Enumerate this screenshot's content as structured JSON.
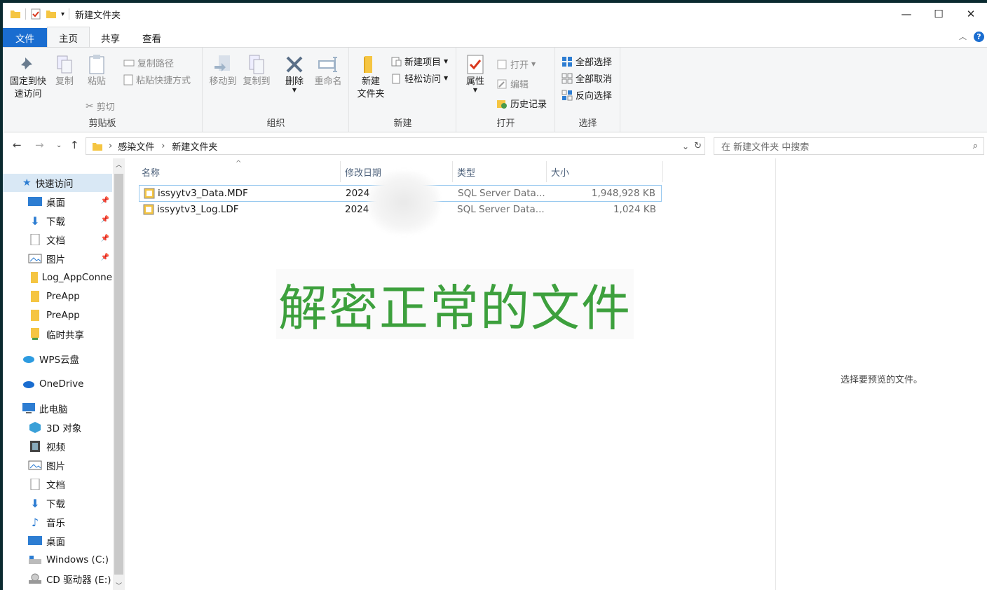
{
  "window": {
    "title": "新建文件夹",
    "controls": {
      "minimize": "—",
      "maximize": "☐",
      "close": "✕"
    }
  },
  "tabs": {
    "file": "文件",
    "home": "主页",
    "share": "共享",
    "view": "查看"
  },
  "ribbon": {
    "clipboard": {
      "group_label": "剪贴板",
      "pin": "固定到快\n速访问",
      "pin_line1": "固定到快",
      "pin_line2": "速访问",
      "copy": "复制",
      "paste": "粘贴",
      "copy_path": "复制路径",
      "paste_shortcut": "粘贴快捷方式",
      "cut": "剪切"
    },
    "organize": {
      "group_label": "组织",
      "move_to": "移动到",
      "copy_to": "复制到",
      "delete": "删除",
      "rename": "重命名"
    },
    "new": {
      "group_label": "新建",
      "new_folder_line1": "新建",
      "new_folder_line2": "文件夹",
      "new_item": "新建项目",
      "easy_access": "轻松访问"
    },
    "open": {
      "group_label": "打开",
      "properties": "属性",
      "open": "打开",
      "edit": "编辑",
      "history": "历史记录"
    },
    "select": {
      "group_label": "选择",
      "select_all": "全部选择",
      "select_none": "全部取消",
      "invert": "反向选择"
    }
  },
  "address": {
    "crumbs": [
      "感染文件",
      "新建文件夹"
    ],
    "search_placeholder": "在 新建文件夹 中搜索"
  },
  "nav": {
    "quick_access": "快速访问",
    "items": [
      {
        "label": "桌面",
        "pinned": true
      },
      {
        "label": "下载",
        "pinned": true
      },
      {
        "label": "文档",
        "pinned": true
      },
      {
        "label": "图片",
        "pinned": true
      },
      {
        "label": "Log_AppConne",
        "pinned": false
      },
      {
        "label": "PreApp",
        "pinned": false
      },
      {
        "label": "PreApp",
        "pinned": false
      },
      {
        "label": "临时共享",
        "pinned": false
      }
    ],
    "wps": "WPS云盘",
    "onedrive": "OneDrive",
    "this_pc": "此电脑",
    "pc_items": [
      "3D 对象",
      "视频",
      "图片",
      "文档",
      "下载",
      "音乐",
      "桌面",
      "Windows (C:)",
      "CD 驱动器 (E:)"
    ]
  },
  "columns": {
    "name": "名称",
    "modified": "修改日期",
    "type": "类型",
    "size": "大小"
  },
  "files": [
    {
      "name": "issyytv3_Data.MDF",
      "modified": "2024",
      "type": "SQL Server Data...",
      "size": "1,948,928 KB"
    },
    {
      "name": "issyytv3_Log.LDF",
      "modified": "2024",
      "type": "SQL Server Data...",
      "size": "1,024 KB"
    }
  ],
  "overlay_text": "解密正常的文件",
  "preview_text": "选择要预览的文件。",
  "colors": {
    "accent": "#1a6dd0",
    "overlay_text": "#3da03d",
    "selection": "#d9e8f5"
  }
}
